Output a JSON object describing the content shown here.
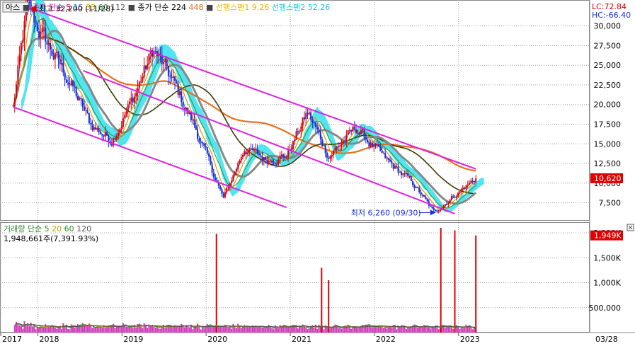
{
  "price_legend": [
    {
      "text": "아스",
      "color": "#000000"
    },
    {
      "text": "■",
      "color": "#444444"
    },
    {
      "text": "종가 단순 5",
      "color": "#cc0099"
    },
    {
      "text": "15",
      "color": "#4a6bd6"
    },
    {
      "text": "33",
      "color": "#c8a000"
    },
    {
      "text": "60",
      "color": "#2e8b2e"
    },
    {
      "text": "112",
      "color": "#555555"
    },
    {
      "text": "■",
      "color": "#444444"
    },
    {
      "text": "종가 단순 224",
      "color": "#000000"
    },
    {
      "text": "448",
      "color": "#e0701a"
    },
    {
      "text": "■",
      "color": "#444444"
    },
    {
      "text": "선행스팬1 9,26",
      "color": "#e8b800"
    },
    {
      "text": "선행스팬2 52,26",
      "color": "#19c6e8"
    }
  ],
  "lc_label": "LC:72.84",
  "hc_label": "HC:-66.40",
  "max_label": "최고 32,200 (11/28)",
  "min_label": "최저 6,260 (09/30)",
  "price_tag": "10,620",
  "volume_legend": [
    {
      "text": "거래량 단순 5",
      "color": "#2e8b2e"
    },
    {
      "text": "20",
      "color": "#c8a000"
    },
    {
      "text": "60",
      "color": "#2e8b2e"
    },
    {
      "text": "120",
      "color": "#555555"
    }
  ],
  "volume_info": "1,948,661주(7,391.93%)",
  "volume_tag": "1,949K",
  "date_right": "03/28",
  "colors": {
    "candle_up": "#e00000",
    "candle_down": "#1a2fd6",
    "channel": "#e020e0",
    "cloud": "#33e0f0",
    "ma224": "#3b3b00",
    "ma448": "#e8701a",
    "ma112": "#888888",
    "ma60": "#3a9a3a",
    "ma33": "#d0a000",
    "ma15": "#4a6bd6",
    "ma5": "#cc0099",
    "grid": "#a0a0a0"
  },
  "chart_data": [
    {
      "type": "candlestick",
      "title": "",
      "x_ticks": [
        "2017",
        "2018",
        "2019",
        "2020",
        "2021",
        "2022",
        "2023"
      ],
      "y_ticks": [
        7500,
        10000,
        12500,
        15000,
        17500,
        20000,
        22500,
        25000,
        27500,
        30000
      ],
      "y_tick_labels": [
        "7,500",
        "10,000",
        "12,500",
        "15,000",
        "17,500",
        "20,000",
        "22,500",
        "25,000",
        "27,500",
        "30,000"
      ],
      "ylim": [
        5300,
        33300
      ],
      "grid": true,
      "max_annotation": {
        "date": "2017-11-28",
        "value": 32200
      },
      "min_annotation": {
        "date": "2022-09-30",
        "value": 6260
      },
      "last_close": 10620,
      "close_path": [
        {
          "date": "2017-09",
          "close": 19500
        },
        {
          "date": "2017-11",
          "close": 32200
        },
        {
          "date": "2018-02",
          "close": 27500
        },
        {
          "date": "2018-05",
          "close": 23000
        },
        {
          "date": "2018-08",
          "close": 17500
        },
        {
          "date": "2018-11",
          "close": 15500
        },
        {
          "date": "2019-02",
          "close": 20500
        },
        {
          "date": "2019-05",
          "close": 27000
        },
        {
          "date": "2019-08",
          "close": 22500
        },
        {
          "date": "2019-11",
          "close": 17000
        },
        {
          "date": "2020-03",
          "close": 8000
        },
        {
          "date": "2020-06",
          "close": 14500
        },
        {
          "date": "2020-09",
          "close": 13000
        },
        {
          "date": "2020-12",
          "close": 13500
        },
        {
          "date": "2021-03",
          "close": 19000
        },
        {
          "date": "2021-06",
          "close": 13500
        },
        {
          "date": "2021-10",
          "close": 17000
        },
        {
          "date": "2022-02",
          "close": 13000
        },
        {
          "date": "2022-06",
          "close": 10000
        },
        {
          "date": "2022-09",
          "close": 6260
        },
        {
          "date": "2022-12",
          "close": 8500
        },
        {
          "date": "2023-03",
          "close": 10620
        }
      ],
      "channel_lines": [
        {
          "start": {
            "date": "2017-11",
            "value": 32400
          },
          "end": {
            "date": "2023-03",
            "value": 11800
          }
        },
        {
          "start": {
            "date": "2018-07",
            "value": 24300
          },
          "end": {
            "date": "2022-12",
            "value": 6100
          }
        },
        {
          "start": {
            "date": "2017-09",
            "value": 19700
          },
          "end": {
            "date": "2020-12",
            "value": 6900
          }
        }
      ]
    },
    {
      "type": "bar",
      "title": "",
      "y_ticks": [
        500000,
        1000000,
        1500000,
        2000000
      ],
      "y_tick_labels": [
        "500,000",
        "1,000K",
        "1,500K",
        "2,000K"
      ],
      "ylim": [
        0,
        2200000
      ],
      "last_volume": 1948661,
      "spikes": [
        {
          "date": "2020-02",
          "volume": 1980000
        },
        {
          "date": "2021-05",
          "volume": 1300000
        },
        {
          "date": "2021-06",
          "volume": 1050000
        },
        {
          "date": "2022-10",
          "volume": 2100000
        },
        {
          "date": "2022-12",
          "volume": 2050000
        },
        {
          "date": "2023-03",
          "volume": 1948661
        }
      ]
    }
  ]
}
